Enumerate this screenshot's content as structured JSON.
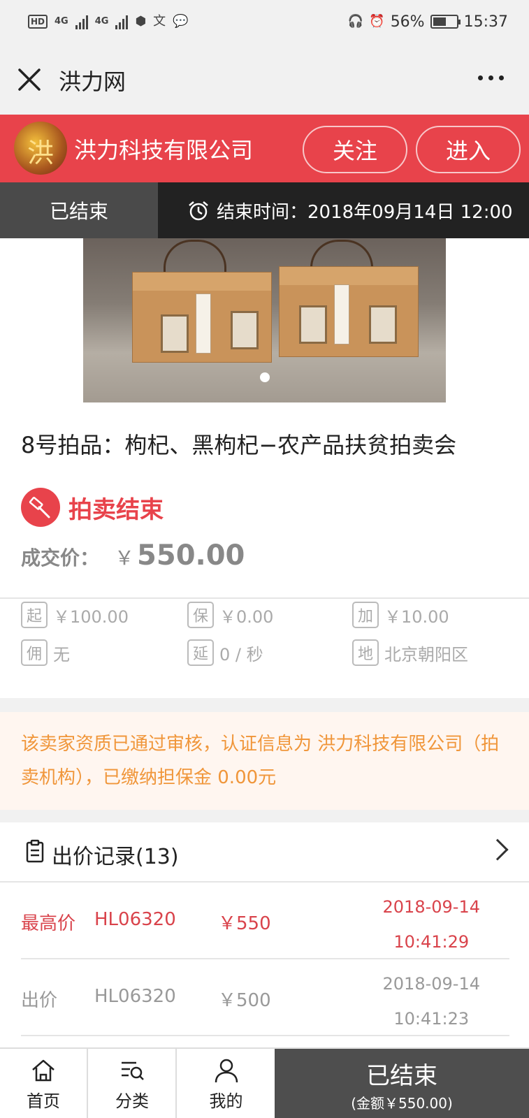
{
  "status_bar": {
    "hd": "HD",
    "net1": "4G",
    "net2": "4G",
    "battery_pct": "56%",
    "battery_level": 0.56,
    "time": "15:37"
  },
  "title_bar": {
    "title": "洪力网"
  },
  "seller": {
    "avatar_text": "洪",
    "name": "洪力科技有限公司",
    "follow_label": "关注",
    "enter_label": "进入"
  },
  "auction_bar": {
    "state": "已结束",
    "end_time_label": "结束时间：",
    "end_time": "2018年09月14日 12:00"
  },
  "product": {
    "title": "8号拍品：枸杞、黑枸杞−农产品扶贫拍卖会",
    "status": "拍卖结束",
    "deal_label": "成交价：",
    "currency": "￥",
    "deal_price": "550.00"
  },
  "params": {
    "start_tag": "起",
    "start_value": "￥100.00",
    "deposit_tag": "保",
    "deposit_value": "￥0.00",
    "increment_tag": "加",
    "increment_value": "￥10.00",
    "commission_tag": "佣",
    "commission_value": "无",
    "delay_tag": "延",
    "delay_value": "0 / 秒",
    "location_tag": "地",
    "location_value": "北京朝阳区"
  },
  "notice": {
    "text": "该卖家资质已通过审核，认证信息为 洪力科技有限公司（拍卖机构），已缴纳担保金 0.00元"
  },
  "bids": {
    "header": "出价记录(13)",
    "rows": [
      {
        "type": "最高价",
        "user": "HL06320",
        "price": "￥550",
        "date": "2018-09-14",
        "time": "10:41:29"
      },
      {
        "type": "出价",
        "user": "HL06320",
        "price": "￥500",
        "date": "2018-09-14",
        "time": "10:41:23"
      }
    ]
  },
  "bottom_nav": {
    "home": "首页",
    "category": "分类",
    "me": "我的",
    "status": "已结束",
    "amount": "(金额￥550.00)"
  },
  "colors": {
    "brand_red": "#e8434b",
    "notice_orange": "#f0963a",
    "dark_gray": "#4e4e4e"
  }
}
